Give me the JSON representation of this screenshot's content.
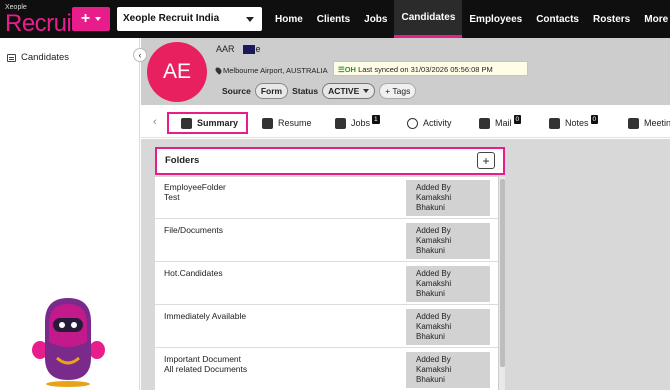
{
  "app": {
    "brand_small": "Xeople",
    "brand": "Recruit"
  },
  "org_select": {
    "value": "Xeople Recruit India"
  },
  "nav": {
    "items": [
      {
        "label": "Home"
      },
      {
        "label": "Clients"
      },
      {
        "label": "Jobs"
      },
      {
        "label": "Candidates"
      },
      {
        "label": "Employees"
      },
      {
        "label": "Contacts"
      },
      {
        "label": "Rosters"
      },
      {
        "label": "More"
      }
    ],
    "active": "Candidates"
  },
  "sidebar": {
    "item": "Candidates"
  },
  "candidate": {
    "initials": "AE",
    "name_prefix": "AAR",
    "name_suffix": "e",
    "location": "Melbourne Airport, AUSTRALIA",
    "sync_tag": "☰OH",
    "sync_text": "Last synced on 31/03/2026 05:56:08 PM",
    "source_label": "Source",
    "source_value": "Form",
    "status_label": "Status",
    "status_value": "ACTIVE",
    "tags_label": "Tags"
  },
  "tabs": [
    {
      "label": "Summary",
      "badge": ""
    },
    {
      "label": "Resume",
      "badge": ""
    },
    {
      "label": "Jobs",
      "badge": "1"
    },
    {
      "label": "Activity",
      "badge": ""
    },
    {
      "label": "Mail",
      "badge": "0"
    },
    {
      "label": "Notes",
      "badge": "0"
    },
    {
      "label": "Meeting",
      "badge": ""
    }
  ],
  "folders": {
    "title": "Folders",
    "rows": [
      {
        "name_line1": "EmployeeFolder",
        "name_line2": "Test",
        "added_line1": "Added By",
        "added_line2": "Kamakshi",
        "added_line3": "Bhakuni"
      },
      {
        "name_line1": "File/Documents",
        "name_line2": "",
        "added_line1": "Added By",
        "added_line2": "Kamakshi",
        "added_line3": "Bhakuni"
      },
      {
        "name_line1": "Hot.Candidates",
        "name_line2": "",
        "added_line1": "Added By",
        "added_line2": "Kamakshi",
        "added_line3": "Bhakuni"
      },
      {
        "name_line1": "Immediately Available",
        "name_line2": "",
        "added_line1": "Added By",
        "added_line2": "Kamakshi",
        "added_line3": "Bhakuni"
      },
      {
        "name_line1": "Important Document",
        "name_line2": "All related Documents",
        "added_line1": "Added By",
        "added_line2": "Kamakshi",
        "added_line3": "Bhakuni"
      }
    ]
  },
  "colors": {
    "accent": "#e81d8c",
    "avatar": "#e8205f",
    "topbar": "#0f0f0f"
  }
}
